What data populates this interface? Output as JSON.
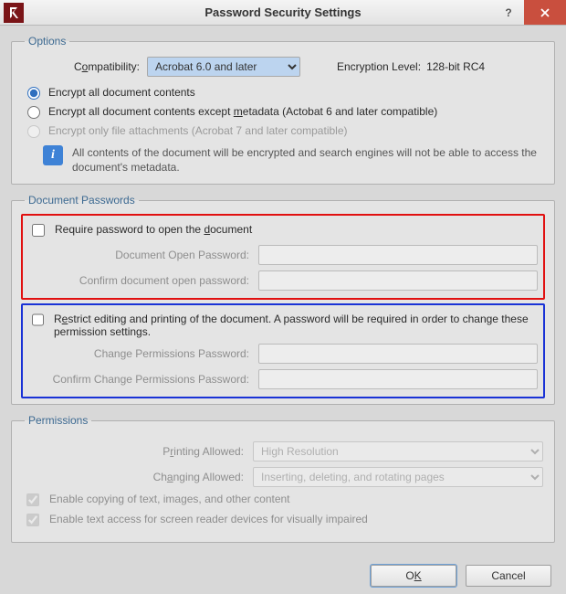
{
  "titlebar": {
    "title": "Password Security Settings",
    "help": "?",
    "close": "×"
  },
  "options": {
    "legend": "Options",
    "compat_label_pre": "C",
    "compat_label_u": "o",
    "compat_label_post": "mpatibility:",
    "compat_value": "Acrobat 6.0 and later",
    "enc_label": "Encryption Level:",
    "enc_value": "128-bit RC4",
    "radio1": "Encrypt all document contents",
    "radio2_pre": "Encrypt all document contents except ",
    "radio2_u": "m",
    "radio2_mid": "etadata (Actobat 6 and later compatible)",
    "radio3": "Encrypt only file attachments (Acrobat 7 and later compatible)",
    "info": "All contents of the document will be encrypted and search engines will not be able to access the document's metadata."
  },
  "docpass": {
    "legend": "Document Passwords",
    "require_pre": "Require password to open the ",
    "require_u": "d",
    "require_post": "ocument",
    "open_label": "Document Open Password:",
    "open_confirm_label": "Confirm document open password:",
    "restrict_pre": "R",
    "restrict_u": "e",
    "restrict_post": "strict editing and printing of the document. A password will be required in order to change these permission settings.",
    "change_label": "Change Permissions Password:",
    "change_confirm_label": "Confirm Change Permissions Password:"
  },
  "perms": {
    "legend": "Permissions",
    "printing_label_pre": "P",
    "printing_label_u": "r",
    "printing_label_post": "inting Allowed:",
    "printing_value": "High Resolution",
    "changing_label_pre": "Ch",
    "changing_label_u": "a",
    "changing_label_post": "nging Allowed:",
    "changing_value": "Inserting, deleting, and rotating pages",
    "enable_copy": "Enable copying of text, images, and other content",
    "enable_screen": "Enable text access for screen reader devices for visually impaired"
  },
  "footer": {
    "ok_pre": "O",
    "ok_u": "K",
    "cancel": "Cancel"
  }
}
